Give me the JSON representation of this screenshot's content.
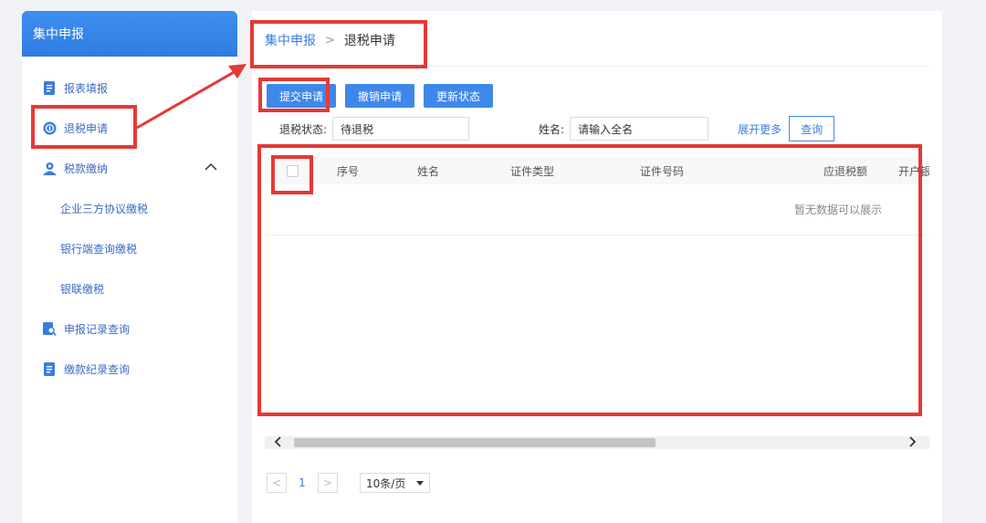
{
  "sidebar": {
    "title": "集中申报",
    "items": [
      {
        "label": "报表填报",
        "icon": "document-icon"
      },
      {
        "label": "退税申请",
        "icon": "refund-icon"
      },
      {
        "label": "税款缴纳",
        "icon": "user-icon"
      },
      {
        "label": "企业三方协议缴税"
      },
      {
        "label": "银行端查询缴税"
      },
      {
        "label": "银联缴税"
      },
      {
        "label": "申报记录查询",
        "icon": "search-record-icon"
      },
      {
        "label": "缴款纪录查询",
        "icon": "document-icon"
      }
    ]
  },
  "breadcrumb": {
    "root": "集中申报",
    "separator": ">",
    "current": "退税申请"
  },
  "toolbar": {
    "submit": "提交申请",
    "revoke": "撤销申请",
    "refresh": "更新状态"
  },
  "filters": {
    "status_label": "退税状态:",
    "status_value": "待退税",
    "name_label": "姓名:",
    "name_placeholder": "请输入全名",
    "more": "展开更多",
    "query": "查询"
  },
  "table": {
    "headers": [
      "序号",
      "姓名",
      "证件类型",
      "证件号码",
      "应退税额",
      "开户银行",
      "开"
    ],
    "empty_text": "暂无数据可以展示"
  },
  "pagination": {
    "prev": "<",
    "page": "1",
    "next": ">",
    "page_size": "10条/页"
  },
  "colors": {
    "accent": "#3e88ea",
    "annotation": "#e53935"
  }
}
